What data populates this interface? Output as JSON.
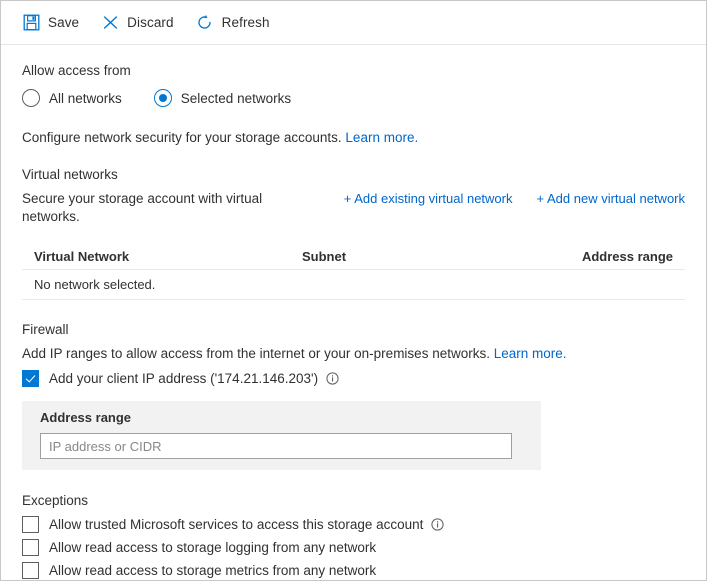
{
  "toolbar": {
    "buttons": [
      {
        "label": "Save",
        "icon": "save-icon"
      },
      {
        "label": "Discard",
        "icon": "discard-icon"
      },
      {
        "label": "Refresh",
        "icon": "refresh-icon"
      }
    ]
  },
  "access": {
    "heading": "Allow access from",
    "options": [
      {
        "label": "All networks",
        "selected": false
      },
      {
        "label": "Selected networks",
        "selected": true
      }
    ]
  },
  "description": {
    "text": "Configure network security for your storage accounts.",
    "link": "Learn more."
  },
  "virtual_networks": {
    "heading": "Virtual networks",
    "subtext": "Secure your storage account with virtual networks.",
    "add_existing_link": "+ Add existing virtual network",
    "add_new_link": "+ Add new virtual network",
    "table": {
      "columns": [
        "Virtual Network",
        "Subnet",
        "Address range"
      ],
      "empty_message": "No network selected."
    }
  },
  "firewall": {
    "heading": "Firewall",
    "subtext": "Add IP ranges to allow access from the internet or your on-premises networks.",
    "link": "Learn more.",
    "client_ip_checkbox": {
      "label": "Add your client IP address ('174.21.146.203')",
      "checked": true,
      "info_icon": "info-icon"
    },
    "address_range": {
      "label": "Address range",
      "value": "",
      "placeholder": "IP address or CIDR"
    }
  },
  "exceptions": {
    "heading": "Exceptions",
    "items": [
      {
        "label": "Allow trusted Microsoft services to access this storage account",
        "checked": false,
        "info_icon": "info-icon"
      },
      {
        "label": "Allow read access to storage logging from any network",
        "checked": false
      },
      {
        "label": "Allow read access to storage metrics from any network",
        "checked": false
      }
    ]
  },
  "colors": {
    "accent": "#0078d4",
    "link": "#0066cc",
    "text": "#323130",
    "field_bg": "#f2f2f2"
  }
}
